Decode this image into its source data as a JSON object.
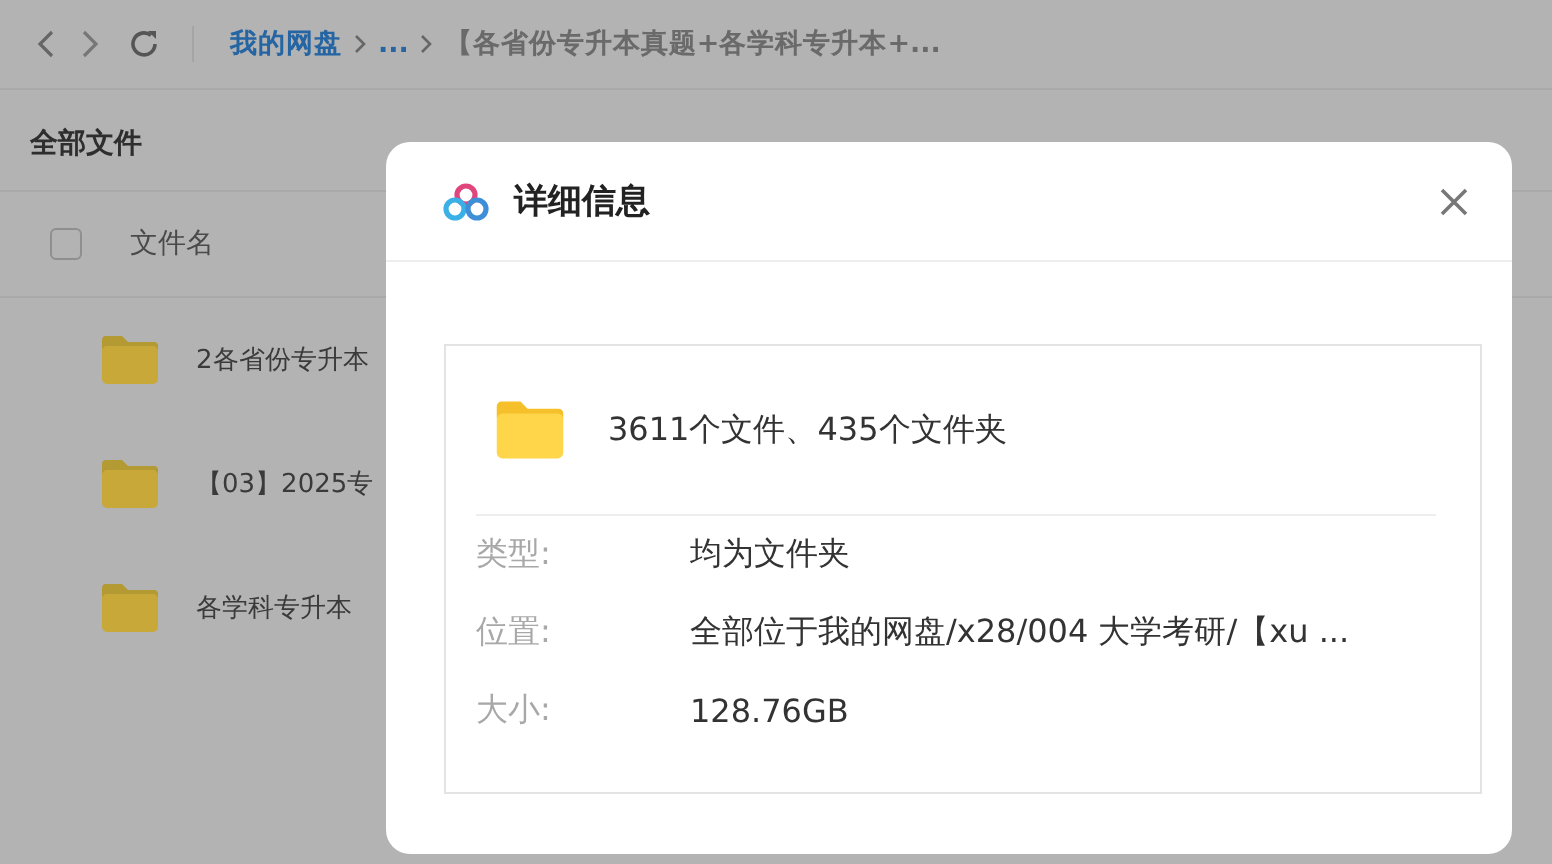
{
  "toolbar": {
    "breadcrumb": [
      {
        "label": "我的网盘",
        "kind": "link"
      },
      {
        "label": "...",
        "kind": "link"
      },
      {
        "label": "【各省份专升本真题+各学科专升本+...",
        "kind": "current"
      }
    ]
  },
  "page_title": "全部文件",
  "file_list": {
    "select_all": {
      "checked": false
    },
    "column": "文件名",
    "rows": [
      {
        "name": "2各省份专升本"
      },
      {
        "name": "【03】2025专"
      },
      {
        "name": "各学科专升本"
      }
    ]
  },
  "dialog": {
    "title": "详细信息",
    "summary": "3611个文件、435个文件夹",
    "fields": [
      {
        "label": "类型:",
        "value": "均为文件夹"
      },
      {
        "label": "位置:",
        "value": "全部位于我的网盘/x28/004 大学考研/【xu ..."
      },
      {
        "label": "大小:",
        "value": "128.76GB"
      }
    ]
  }
}
